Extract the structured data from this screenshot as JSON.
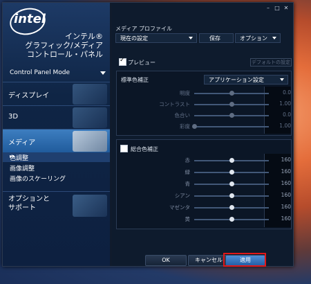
{
  "app": {
    "logo_text": "intel",
    "title_lines": [
      "インテル®",
      "グラフィック/メディア",
      "コントロール・パネル"
    ]
  },
  "left_panel": {
    "mode": "Control Panel Mode",
    "nav": [
      {
        "label": "ディスプレイ"
      },
      {
        "label": "3D"
      },
      {
        "label": "メディア"
      }
    ],
    "sub_items": [
      "色調整",
      "画像調整",
      "画像のスケーリング"
    ],
    "sub_active_marker": "▸▸",
    "options_lines": [
      "オプションと",
      "サポート"
    ],
    "help": "?"
  },
  "media_profile": {
    "title": "メディア プロファイル",
    "current": "現在の設定",
    "save": "保存",
    "options": "オプション"
  },
  "preview": {
    "label": "プレビュー",
    "checked": true
  },
  "default_button": "デフォルトの設定",
  "standard": {
    "title": "標準色補正",
    "mode": "アプリケーション設定",
    "rows": [
      {
        "name": "明度",
        "value": "0.0",
        "level": 0.5
      },
      {
        "name": "コントラスト",
        "value": "1.00",
        "level": 0.5
      },
      {
        "name": "色合い",
        "value": "0.0",
        "level": 0.5
      },
      {
        "name": "彩度",
        "value": "1.00",
        "level": 0.0
      }
    ]
  },
  "total": {
    "title": "総合色補正",
    "checked": false,
    "rows": [
      {
        "name": "赤",
        "value": "160",
        "level": 0.5
      },
      {
        "name": "緑",
        "value": "160",
        "level": 0.5
      },
      {
        "name": "青",
        "value": "160",
        "level": 0.5
      },
      {
        "name": "シアン",
        "value": "160",
        "level": 0.5
      },
      {
        "name": "マゼンタ",
        "value": "160",
        "level": 0.5
      },
      {
        "name": "黄",
        "value": "160",
        "level": 0.5
      }
    ]
  },
  "window_buttons": [
    "–",
    "□",
    "✕"
  ],
  "bottom": {
    "ok": "OK",
    "cancel": "キャンセル",
    "apply": "適用"
  },
  "colors": {
    "accent": "#2f6fb8",
    "highlight_box": "#e01818"
  }
}
